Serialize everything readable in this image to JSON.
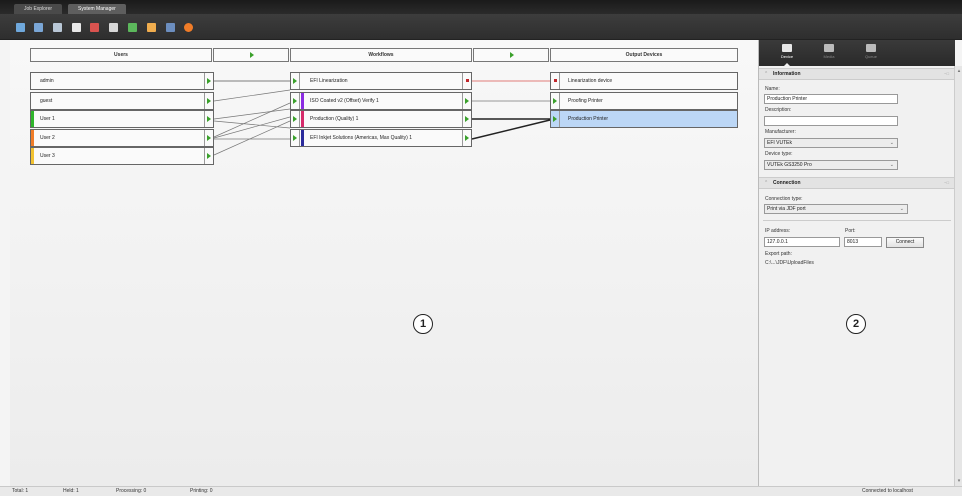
{
  "tabs": [
    "Job Explorer",
    "System Manager"
  ],
  "toolbar": {
    "buttons": [
      {
        "icon": "network-icon",
        "color": "#6fa8dc"
      },
      {
        "icon": "folder-icon",
        "color": "#7aa6d6"
      },
      {
        "icon": "printer-icon",
        "color": "#b9c7d6"
      },
      {
        "icon": "document-icon",
        "color": "#e8e8e8"
      },
      {
        "icon": "form-icon",
        "color": "#d9534f"
      },
      {
        "icon": "chart-icon",
        "color": "#d8d8d8"
      },
      {
        "icon": "color-icon",
        "color": "#5cb85c"
      },
      {
        "icon": "palette-icon",
        "color": "#f0ad4e"
      },
      {
        "icon": "table-icon",
        "color": "#6c8ebf"
      },
      {
        "icon": "stop-icon",
        "color": "#f07c28"
      }
    ]
  },
  "columns": {
    "users": "Users",
    "workflows": "Workflows",
    "output_devices": "Output Devices"
  },
  "users": [
    {
      "name": "admin",
      "color": ""
    },
    {
      "name": "guest",
      "color": ""
    },
    {
      "name": "User 1",
      "color": "#2fb52b"
    },
    {
      "name": "User 2",
      "color": "#f07c28"
    },
    {
      "name": "User 3",
      "color": "#f2c230"
    }
  ],
  "workflows": [
    {
      "name": "EFI Linearization",
      "color": "",
      "status": "error"
    },
    {
      "name": "ISO Coated v2 (Offset) Verify 1",
      "color": "#8b2be2",
      "status": "ok"
    },
    {
      "name": "Production (Quality) 1",
      "color": "#d62b6a",
      "status": "ok"
    },
    {
      "name": "EFI Inkjet Solutions (Americas, Max Quality) 1",
      "color": "#2b2b9c",
      "status": "ok"
    }
  ],
  "devices": [
    {
      "name": "Linearization device",
      "status": "error",
      "selected": false
    },
    {
      "name": "Proofing Printer",
      "status": "ok",
      "selected": false
    },
    {
      "name": "Production Printer",
      "status": "ok",
      "selected": true
    }
  ],
  "callouts": [
    "1",
    "2"
  ],
  "panel": {
    "tabs": [
      {
        "label": "Device",
        "icon": "printer-icon",
        "active": true
      },
      {
        "label": "Media",
        "icon": "media-icon",
        "active": false
      },
      {
        "label": "Queue",
        "icon": "queue-icon",
        "active": false
      }
    ],
    "information": {
      "title": "Information",
      "name_label": "Name:",
      "name_value": "Production Printer",
      "description_label": "Description:",
      "description_value": "",
      "manufacturer_label": "Manufacturer:",
      "manufacturer_value": "EFI VUTEk",
      "device_type_label": "Device type:",
      "device_type_value": "VUTEk GS3250 Pro"
    },
    "connection": {
      "title": "Connection",
      "type_label": "Connection type:",
      "type_value": "Print via JDF port",
      "ip_label": "IP address:",
      "ip_value": "127.0.0.1",
      "port_label": "Port:",
      "port_value": "8013",
      "connect_button": "Connect",
      "export_label": "Export path:",
      "export_value": "C:\\...\\JDF\\UploadFiles"
    }
  },
  "status": {
    "total": "Total: 1",
    "held": "Held: 1",
    "processing": "Processing: 0",
    "printing": "Printing: 0",
    "connection": "Connected to localhost"
  }
}
